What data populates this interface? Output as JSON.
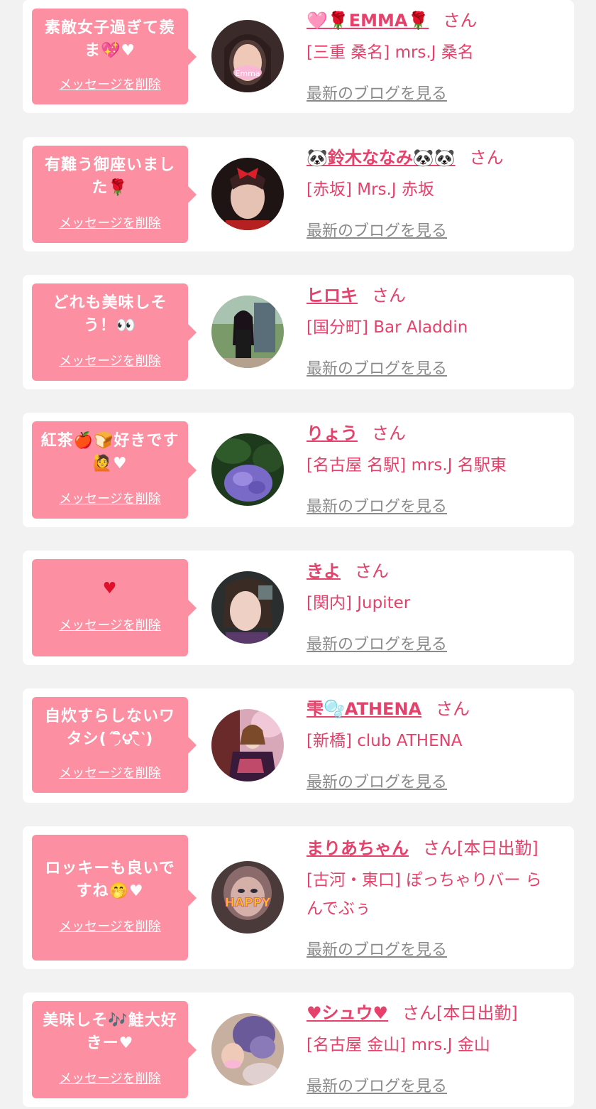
{
  "colors": {
    "page_bg": "#f2f2f2",
    "card_bg": "#ffffff",
    "bubble_bg": "#fc8fa2",
    "name_color": "#e5416b",
    "blog_link": "#8a8a8a"
  },
  "delete_label": "メッセージを削除",
  "blog_label": "最新のブログを見る",
  "items": [
    {
      "message": "素敵女子過ぎて羨\nま💖♥",
      "name": "🩷🌹EMMA🌹",
      "suffix": "さん",
      "shop": "[三重 桑名] mrs.J 桑名",
      "avatar": "photo-woman-emma",
      "avatar_caption": "Emma"
    },
    {
      "message": "有難う御座いまし\nた🌹",
      "name": "🐼鈴木ななみ🐼🐼",
      "suffix": "さん",
      "shop": "[赤坂] Mrs.J 赤坂",
      "avatar": "photo-woman-red-bow",
      "avatar_caption": ""
    },
    {
      "message": "どれも美味しそ\nう！👀",
      "name": "ヒロキ",
      "suffix": "さん",
      "shop": "[国分町] Bar Aladdin",
      "avatar": "photo-woman-standing",
      "avatar_caption": ""
    },
    {
      "message": "紅茶🍎🍞好きです\n🙋♥",
      "name": "りょう",
      "suffix": "さん",
      "shop": "[名古屋 名駅] mrs.J 名駅東",
      "avatar": "photo-hydrangea",
      "avatar_caption": ""
    },
    {
      "message": "♥",
      "name": "きよ",
      "suffix": "さん",
      "shop": "[関内] Jupiter",
      "avatar": "photo-woman-selfie",
      "avatar_caption": ""
    },
    {
      "message": "自炊すらしないワ\nタシ(΄◞ิ౪◟ิ‵)",
      "name": "雫🫧ATHENA",
      "suffix": "さん",
      "shop": "[新橋] club ATHENA",
      "avatar": "photo-woman-kimono",
      "avatar_caption": ""
    },
    {
      "message": "ロッキーも良いで\nすね🤭♥",
      "name": "まりあちゃん",
      "suffix": "さん[本日出勤]",
      "shop": "[古河・東口] ぽっちゃりバー ら\nんでぶぅ",
      "avatar": "photo-woman-happy",
      "avatar_caption": "HAPPY"
    },
    {
      "message": "美味しそ🎶鮭大好\nきー♥",
      "name": "♥シュウ♥",
      "suffix": "さん[本日出勤]",
      "shop": "[名古屋 金山] mrs.J 金山",
      "avatar": "photo-woman-flowers",
      "avatar_caption": ""
    }
  ]
}
